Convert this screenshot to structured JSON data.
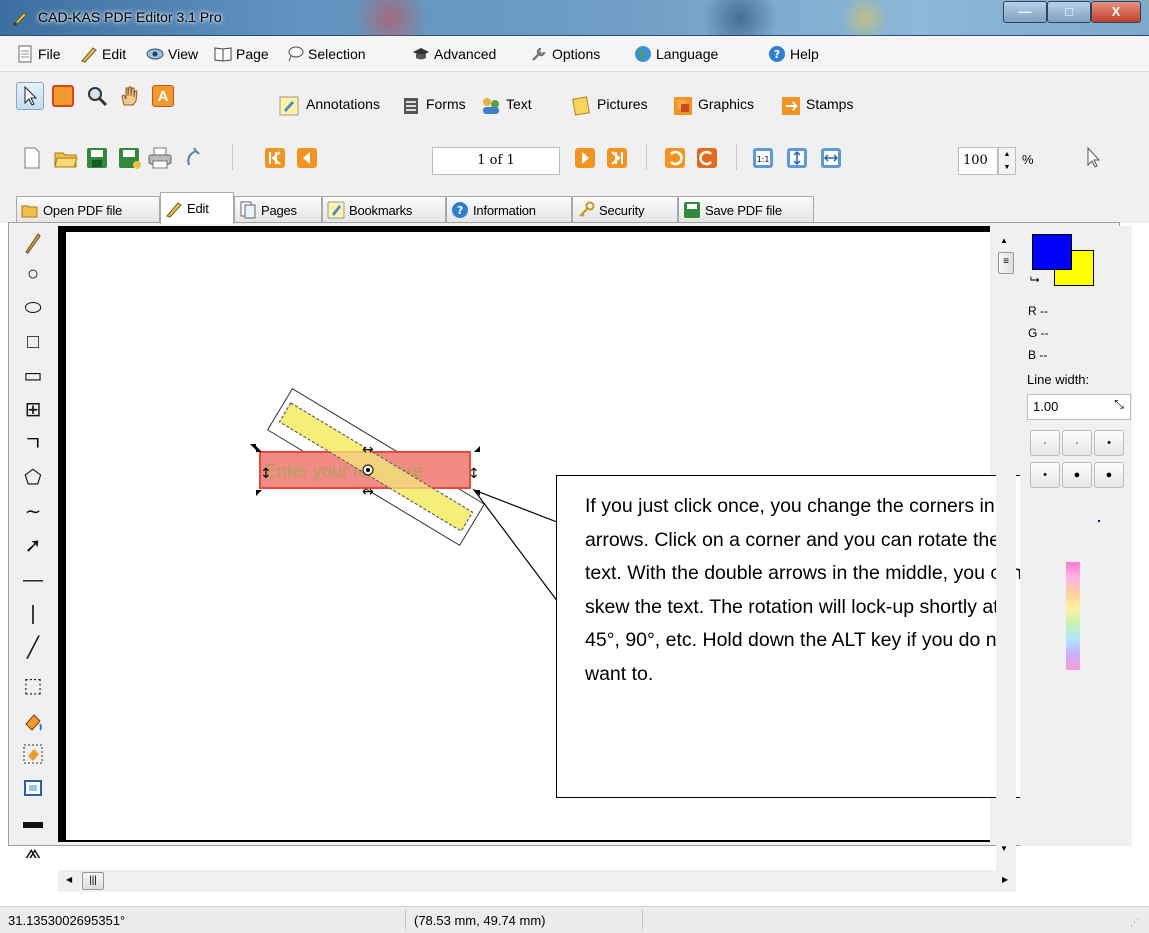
{
  "window": {
    "title": "CAD-KAS PDF Editor 3.1 Pro",
    "controls": {
      "minimize": "—",
      "maximize": "□",
      "close": "X"
    }
  },
  "menu": [
    "File",
    "Edit",
    "View",
    "Page",
    "Selection",
    "Advanced",
    "Options",
    "Language",
    "Help"
  ],
  "toolbar1": {
    "labels": [
      "Annotations",
      "Forms",
      "Text",
      "Pictures",
      "Graphics",
      "Stamps"
    ]
  },
  "toolbar2": {
    "page_value": "1 of 1",
    "zoom_value": "100",
    "zoom_unit": "%"
  },
  "tabs": [
    "Open PDF file",
    "Edit",
    "Pages",
    "Bookmarks",
    "Information",
    "Security",
    "Save PDF file"
  ],
  "active_tab": "Edit",
  "canvas": {
    "textbox_text": "Enter your text here"
  },
  "right_panel": {
    "r": "R --",
    "g": "G --",
    "b": "B --",
    "line_width_label": "Line width:",
    "line_width_value": "1.00"
  },
  "callout": {
    "text": "If you just click once, you change the corners in arrows. Click on a corner and you can rotate the text. With the double arrows in the middle, you can skew the text. The rotation will lock-up shortly at 45°, 90°, etc. Hold down the ALT key if you do not want to."
  },
  "status": {
    "angle": "31.1353002695351°",
    "position": "(78.53 mm, 49.74 mm)"
  },
  "colors": {
    "foreground": "#0000ff",
    "background": "#ffff00",
    "textbox_fill": "#f28b84",
    "rotated_fill": "#f5ef7a"
  }
}
